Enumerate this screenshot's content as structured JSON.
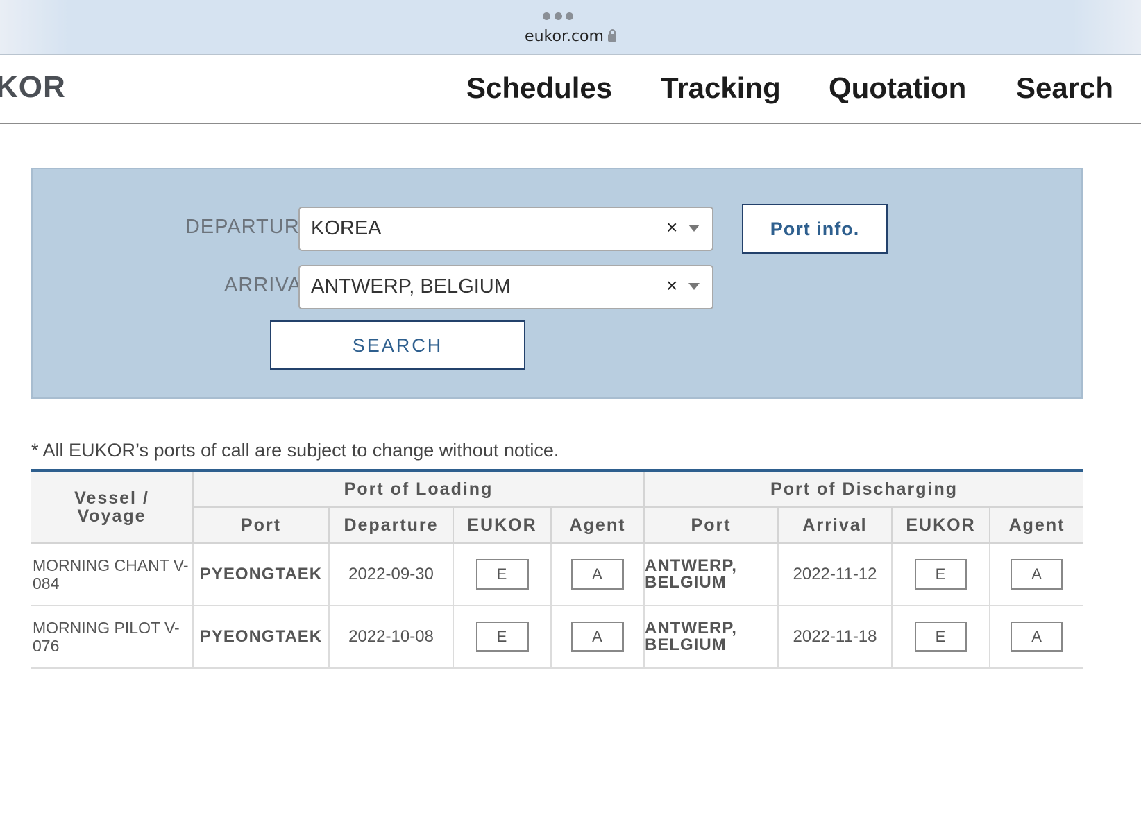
{
  "browser": {
    "url": "eukor.com"
  },
  "header": {
    "logo": "KOR",
    "nav": [
      "Schedules",
      "Tracking",
      "Quotation",
      "Search"
    ]
  },
  "search_form": {
    "departure_label": "DEPARTURE",
    "departure_value": "KOREA",
    "arrival_label": "ARRIVAL",
    "arrival_value": "ANTWERP, BELGIUM",
    "clear_glyph": "×",
    "port_info_label": "Port info.",
    "search_label": "SEARCH"
  },
  "notice": "* All EUKOR’s ports of call are subject to change without notice.",
  "table": {
    "headers": {
      "vessel": "Vessel / Voyage",
      "loading_group": "Port of Loading",
      "discharging_group": "Port of Discharging",
      "port": "Port",
      "departure": "Departure",
      "arrival": "Arrival",
      "eukor": "EUKOR",
      "agent": "Agent"
    },
    "rows": [
      {
        "vessel_voyage": "MORNING CHANT V-084",
        "loading_port": "PYEONGTAEK",
        "departure": "2022-09-30",
        "eukor_btn": "E",
        "agent_btn": "A",
        "discharging_port": "ANTWERP, BELGIUM",
        "arrival": "2022-11-12",
        "eukor_btn2": "E",
        "agent_btn2": "A"
      },
      {
        "vessel_voyage": "MORNING PILOT V-076",
        "loading_port": "PYEONGTAEK",
        "departure": "2022-10-08",
        "eukor_btn": "E",
        "agent_btn": "A",
        "discharging_port": "ANTWERP, BELGIUM",
        "arrival": "2022-11-18",
        "eukor_btn2": "E",
        "agent_btn2": "A"
      }
    ]
  },
  "colors": {
    "panel_bg": "#b9cee0",
    "accent": "#2e5f8e",
    "button_border": "#23416b"
  }
}
